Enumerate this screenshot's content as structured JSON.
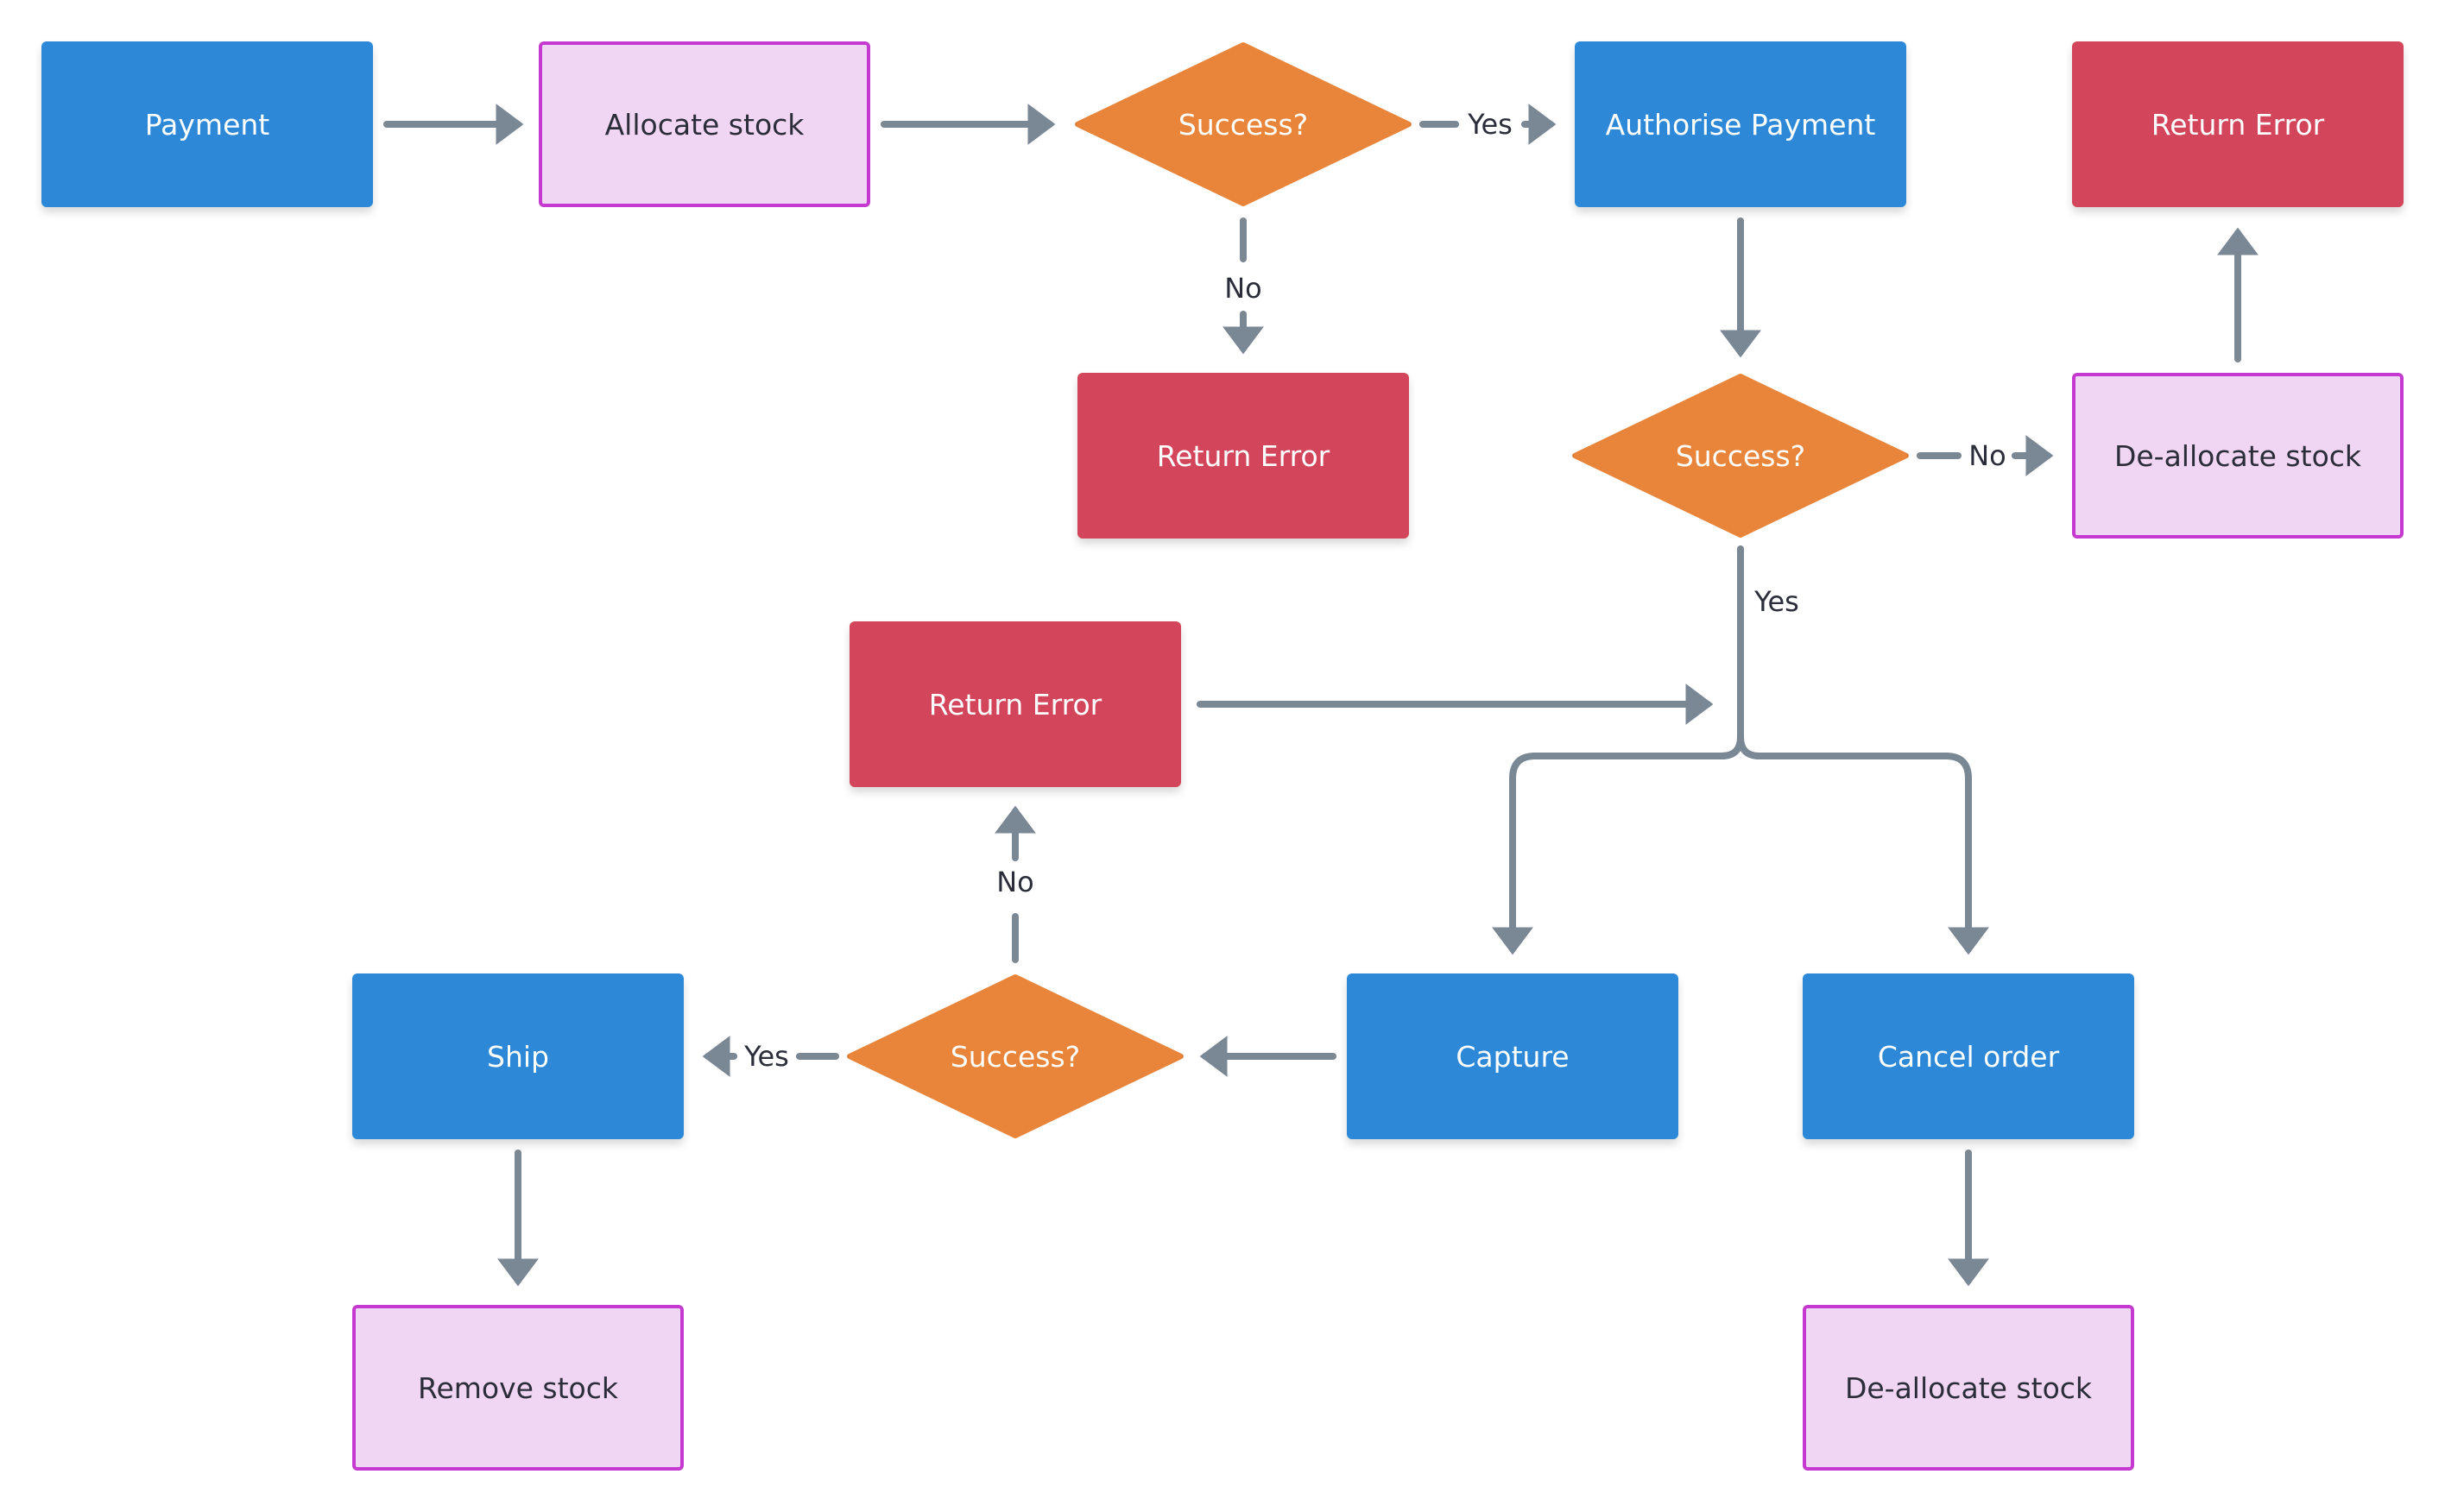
{
  "diagram": {
    "type": "flowchart",
    "colors": {
      "process": "#2D88D8",
      "error": "#D2455B",
      "stock": "#F0D6F3",
      "stock_border": "#C43ACF",
      "decision": "#E8853B",
      "connector": "#7A8896"
    },
    "nodes": {
      "payment": "Payment",
      "allocate_stock": "Allocate stock",
      "success_1": "Success?",
      "authorise_payment": "Authorise Payment",
      "return_error_1": "Return Error",
      "return_error_2": "Return Error",
      "success_2": "Success?",
      "deallocate_stock_1": "De-allocate stock",
      "return_error_3": "Return Error",
      "ship": "Ship",
      "success_3": "Success?",
      "capture": "Capture",
      "cancel_order": "Cancel order",
      "remove_stock": "Remove stock",
      "deallocate_stock_2": "De-allocate stock"
    },
    "edge_labels": {
      "s1_yes": "Yes",
      "s1_no": "No",
      "s2_no": "No",
      "s2_yes": "Yes",
      "s3_no": "No",
      "s3_yes": "Yes"
    },
    "edges": [
      {
        "from": "Payment",
        "to": "Allocate stock"
      },
      {
        "from": "Allocate stock",
        "to": "Success? (1)"
      },
      {
        "from": "Success? (1)",
        "to": "Authorise Payment",
        "label": "Yes"
      },
      {
        "from": "Success? (1)",
        "to": "Return Error (2)",
        "label": "No"
      },
      {
        "from": "Authorise Payment",
        "to": "Success? (2)"
      },
      {
        "from": "Success? (2)",
        "to": "De-allocate stock (1)",
        "label": "No"
      },
      {
        "from": "De-allocate stock (1)",
        "to": "Return Error (1)"
      },
      {
        "from": "Success? (2)",
        "to": "Capture",
        "label": "Yes"
      },
      {
        "from": "Success? (2)",
        "to": "Cancel order",
        "label": "Yes"
      },
      {
        "from": "Return Error (3)",
        "to": "Yes branch junction"
      },
      {
        "from": "Capture",
        "to": "Success? (3)"
      },
      {
        "from": "Success? (3)",
        "to": "Ship",
        "label": "Yes"
      },
      {
        "from": "Success? (3)",
        "to": "Return Error (3)",
        "label": "No"
      },
      {
        "from": "Ship",
        "to": "Remove stock"
      },
      {
        "from": "Cancel order",
        "to": "De-allocate stock (2)"
      }
    ]
  }
}
